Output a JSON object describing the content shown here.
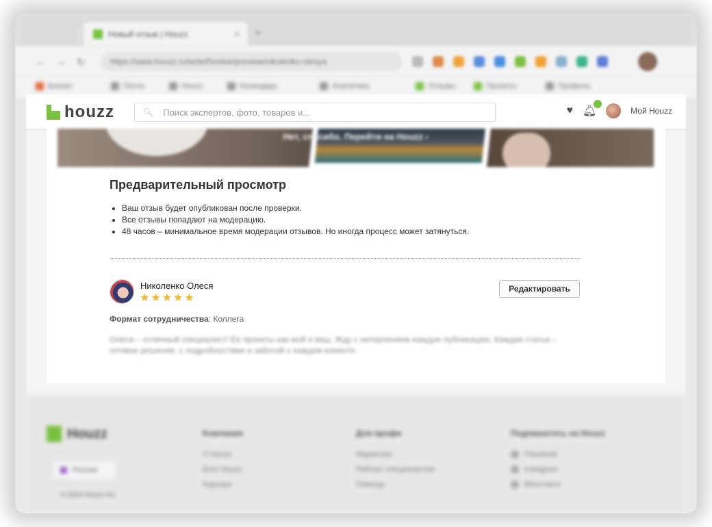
{
  "browser": {
    "tab_title": "Новый отзыв | Houzz",
    "tab_close": "×",
    "new_tab": "+",
    "url": "https://www.houzz.ru/writeReview/preview/nikolenko-olesya",
    "bookmarks": [
      "Бизнес",
      "Почта",
      "Houzz",
      "Календарь",
      "Аналитика",
      "Отзывы",
      "Проекты",
      "Профиль"
    ]
  },
  "header": {
    "logo": "houzz",
    "search_placeholder": "Поиск экспертов, фото, товаров и...",
    "my_houzz": "Мой Houzz"
  },
  "hero": {
    "caption": "Нет, спасибо. Перейти на Houzz ›"
  },
  "preview": {
    "title": "Предварительный просмотр",
    "notes": [
      "Ваш отзыв будет опубликован после проверки.",
      "Все отзывы попадают на модерацию.",
      "48 часов – минимальное время модерации отзывов. Но иногда процесс может затянуться."
    ]
  },
  "review": {
    "author": "Николенко Олеся",
    "rating": 5,
    "star_glyph": "★",
    "edit_label": "Редактировать",
    "format_label": "Формат сотрудничества",
    "format_value": ": Коллега",
    "text": "Олеся – отличный специалист! Ее проекты как мой и ваш. Жду с нетерпением каждую публикацию. Каждая статья – готовое решение, с подробностями и заботой о каждом клиенте."
  },
  "footer": {
    "logo": "Houzz",
    "language": "Россия",
    "copyright": "© 2024 Houzz Inc.",
    "columns": [
      {
        "head": "Компания",
        "links": [
          "О Houzz",
          "Блог Houzz",
          "Карьера"
        ]
      },
      {
        "head": "Для профи",
        "links": [
          "Маркетинг",
          "Рейтинг специалистов",
          "Помощь"
        ]
      },
      {
        "head": "Подпишитесь на Houzz",
        "links": [
          "Facebook",
          "Instagram",
          "ВКонтакте"
        ]
      }
    ]
  },
  "colors": {
    "accent": "#7ac142",
    "star": "#f6b82a"
  }
}
